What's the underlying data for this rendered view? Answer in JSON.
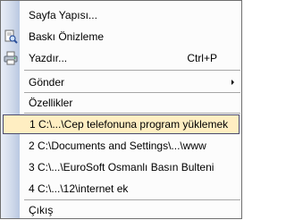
{
  "menu": {
    "items": [
      {
        "label": "Sayfa Yapısı..."
      },
      {
        "label": "Baskı Önizleme"
      },
      {
        "label": "Yazdır...",
        "shortcut": "Ctrl+P"
      },
      {
        "label": "Gönder"
      },
      {
        "label": "Özellikler"
      },
      {
        "label": "1 C:\\...\\Cep telefonuna program yüklemek"
      },
      {
        "label": "2 C:\\Documents and Settings\\...\\www"
      },
      {
        "label": "3 C:\\...\\EuroSoft Osmanlı Basın Bulteni"
      },
      {
        "label": "4 C:\\...\\12\\internet ek"
      },
      {
        "label": "Çıkış"
      }
    ]
  },
  "icons": {
    "print_preview": "print-preview-icon",
    "print": "printer-icon",
    "submenu": "submenu-arrow-icon"
  },
  "colors": {
    "selection_fill": "#ffeec2",
    "selection_border": "#4b4b6f",
    "gutter": "#cfd9ea"
  }
}
